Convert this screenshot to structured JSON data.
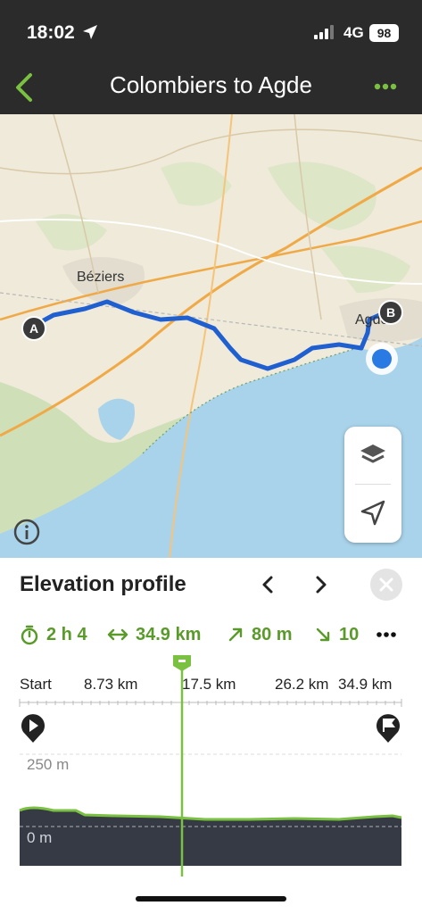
{
  "status": {
    "time": "18:02",
    "network": "4G",
    "battery": "98",
    "icons": [
      "location-arrow-icon",
      "signal-bars-icon"
    ]
  },
  "nav": {
    "title": "Colombiers to Agde",
    "back_icon": "chevron-left-icon",
    "more_icon": "more-dots-icon",
    "accent_color": "#7ac142"
  },
  "map": {
    "labels": {
      "beziers": "Béziers",
      "agde": "Agde"
    },
    "markers": {
      "start": "A",
      "end": "B"
    },
    "route_color": "#1f5fd0",
    "sea_color": "#a9d3ea",
    "controls": [
      "layers-icon",
      "locate-arrow-icon",
      "info-icon"
    ]
  },
  "panel": {
    "title": "Elevation profile",
    "prev_icon": "chevron-left-icon",
    "next_icon": "chevron-right-icon",
    "close_icon": "close-icon",
    "stats": {
      "duration": "2 h 4",
      "distance": "34.9 km",
      "ascent": "80 m",
      "descent": "10"
    },
    "stats_more_icon": "more-dots-icon",
    "axis": {
      "start": "Start",
      "t1": "8.73 km",
      "t2": "17.5 km",
      "t3": "26.2 km",
      "t4": "34.9 km"
    },
    "y_labels": {
      "top": "250 m",
      "bottom": "0 m"
    },
    "line_color": "#7ac142",
    "fill_color": "#353a45"
  }
}
